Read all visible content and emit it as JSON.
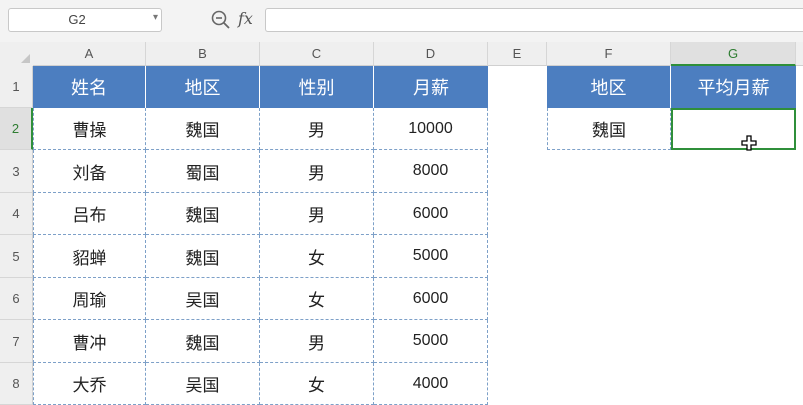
{
  "namebox": {
    "value": "G2"
  },
  "columns": [
    "A",
    "B",
    "C",
    "D",
    "E",
    "F",
    "G"
  ],
  "rows": [
    "1",
    "2",
    "3",
    "4",
    "5",
    "6",
    "7",
    "8"
  ],
  "table": {
    "headers": [
      "姓名",
      "地区",
      "性别",
      "月薪"
    ],
    "rows": [
      [
        "曹操",
        "魏国",
        "男",
        "10000"
      ],
      [
        "刘备",
        "蜀国",
        "男",
        "8000"
      ],
      [
        "吕布",
        "魏国",
        "男",
        "6000"
      ],
      [
        "貂蝉",
        "魏国",
        "女",
        "5000"
      ],
      [
        "周瑜",
        "吴国",
        "女",
        "6000"
      ],
      [
        "曹冲",
        "魏国",
        "男",
        "5000"
      ],
      [
        "大乔",
        "吴国",
        "女",
        "4000"
      ]
    ]
  },
  "summary": {
    "headers": [
      "地区",
      "平均月薪"
    ],
    "region_value": "魏国",
    "result_value": ""
  },
  "icons": {
    "zoom": "zoom-formula-icon",
    "fx": "fx-icon",
    "cursor": "cell-select-cursor-icon"
  },
  "colors": {
    "header_bg": "#4c7ec0",
    "selection": "#2f8f3a"
  },
  "fx_label": "fx"
}
